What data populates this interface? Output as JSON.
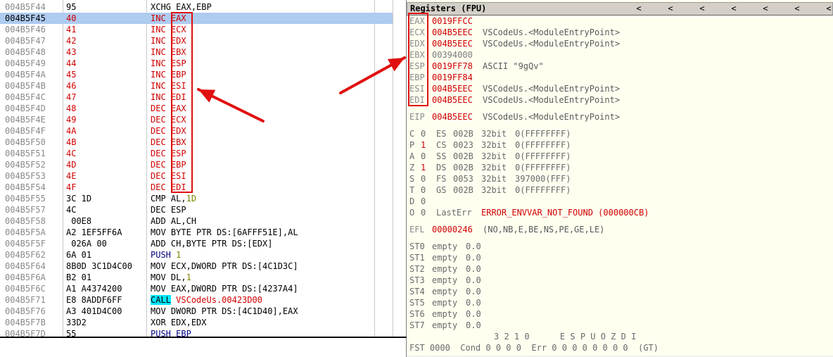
{
  "disassembly": {
    "rows": [
      {
        "addr": "004B5F44",
        "hex": "95",
        "mn": "XCHG",
        "ops": "EAX,EBP",
        "style": "plain"
      },
      {
        "addr": "004B5F45",
        "hex": "40",
        "mn": "INC",
        "ops": "EAX",
        "style": "red"
      },
      {
        "addr": "004B5F46",
        "hex": "41",
        "mn": "INC",
        "ops": "ECX",
        "style": "red"
      },
      {
        "addr": "004B5F47",
        "hex": "42",
        "mn": "INC",
        "ops": "EDX",
        "style": "red"
      },
      {
        "addr": "004B5F48",
        "hex": "43",
        "mn": "INC",
        "ops": "EBX",
        "style": "red"
      },
      {
        "addr": "004B5F49",
        "hex": "44",
        "mn": "INC",
        "ops": "ESP",
        "style": "red"
      },
      {
        "addr": "004B5F4A",
        "hex": "45",
        "mn": "INC",
        "ops": "EBP",
        "style": "red"
      },
      {
        "addr": "004B5F4B",
        "hex": "46",
        "mn": "INC",
        "ops": "ESI",
        "style": "red"
      },
      {
        "addr": "004B5F4C",
        "hex": "47",
        "mn": "INC",
        "ops": "EDI",
        "style": "red"
      },
      {
        "addr": "004B5F4D",
        "hex": "48",
        "mn": "DEC",
        "ops": "EAX",
        "style": "red"
      },
      {
        "addr": "004B5F4E",
        "hex": "49",
        "mn": "DEC",
        "ops": "ECX",
        "style": "red"
      },
      {
        "addr": "004B5F4F",
        "hex": "4A",
        "mn": "DEC",
        "ops": "EDX",
        "style": "red"
      },
      {
        "addr": "004B5F50",
        "hex": "4B",
        "mn": "DEC",
        "ops": "EBX",
        "style": "red"
      },
      {
        "addr": "004B5F51",
        "hex": "4C",
        "mn": "DEC",
        "ops": "ESP",
        "style": "red"
      },
      {
        "addr": "004B5F52",
        "hex": "4D",
        "mn": "DEC",
        "ops": "EBP",
        "style": "red"
      },
      {
        "addr": "004B5F53",
        "hex": "4E",
        "mn": "DEC",
        "ops": "ESI",
        "style": "red"
      },
      {
        "addr": "004B5F54",
        "hex": "4F",
        "mn": "DEC",
        "ops": "EDI",
        "style": "red"
      },
      {
        "addr": "004B5F55",
        "hex": "3C 1D",
        "mn": "CMP",
        "ops": "AL,",
        "num": "1D",
        "style": "num"
      },
      {
        "addr": "004B5F57",
        "hex": "4C",
        "mn": "DEC",
        "ops": "ESP",
        "style": "plain"
      },
      {
        "addr": "004B5F58",
        "hex": " 00E8",
        "mn": "ADD",
        "ops": "AL,CH",
        "style": "plain"
      },
      {
        "addr": "004B5F5A",
        "hex": "A2 1EF5FF6A",
        "mn": "MOV",
        "ops": "BYTE PTR DS:[6AFFF51E],AL",
        "style": "plain"
      },
      {
        "addr": "004B5F5F",
        "hex": " 026A 00",
        "mn": "ADD",
        "ops": "CH,BYTE PTR DS:[EDX]",
        "style": "plain"
      },
      {
        "addr": "004B5F62",
        "hex": "6A 01",
        "mn": "PUSH",
        "ops": "",
        "num": "1",
        "style": "push"
      },
      {
        "addr": "004B5F64",
        "hex": "8B0D 3C1D4C00",
        "mn": "MOV",
        "ops": "ECX,DWORD PTR DS:[4C1D3C]",
        "style": "plain"
      },
      {
        "addr": "004B5F6A",
        "hex": "B2 01",
        "mn": "MOV",
        "ops": "DL,",
        "num": "1",
        "style": "num"
      },
      {
        "addr": "004B5F6C",
        "hex": "A1 A4374200",
        "mn": "MOV",
        "ops": "EAX,DWORD PTR DS:[4237A4]",
        "style": "plain"
      },
      {
        "addr": "004B5F71",
        "hex": "E8 8ADDF6FF",
        "mn": "CALL",
        "ops": "VSCodeUs.00423D00",
        "style": "call"
      },
      {
        "addr": "004B5F76",
        "hex": "A3 401D4C00",
        "mn": "MOV",
        "ops": "DWORD PTR DS:[4C1D40],EAX",
        "style": "plain"
      },
      {
        "addr": "004B5F7B",
        "hex": "33D2",
        "mn": "XOR",
        "ops": "EDX,EDX",
        "style": "plain"
      },
      {
        "addr": "004B5F7D",
        "hex": "55",
        "mn": "PUSH",
        "ops": "EBP",
        "style": "pushreg"
      }
    ]
  },
  "registers": {
    "title": "Registers (FPU)",
    "nav_arrows": [
      "<",
      "<",
      "<",
      "<",
      "<",
      "<",
      "<"
    ],
    "gp": [
      {
        "name": "EAX",
        "value": "0019FFCC",
        "comment": "",
        "changed": true
      },
      {
        "name": "ECX",
        "value": "004B5EEC",
        "comment": "VSCodeUs.<ModuleEntryPoint>",
        "changed": true
      },
      {
        "name": "EDX",
        "value": "004B5EEC",
        "comment": "VSCodeUs.<ModuleEntryPoint>",
        "changed": true
      },
      {
        "name": "EBX",
        "value": "00394000",
        "comment": "",
        "changed": false
      },
      {
        "name": "ESP",
        "value": "0019FF78",
        "comment": "ASCII \"9gQv\"",
        "changed": true
      },
      {
        "name": "EBP",
        "value": "0019FF84",
        "comment": "",
        "changed": true
      },
      {
        "name": "ESI",
        "value": "004B5EEC",
        "comment": "VSCodeUs.<ModuleEntryPoint>",
        "changed": true
      },
      {
        "name": "EDI",
        "value": "004B5EEC",
        "comment": "VSCodeUs.<ModuleEntryPoint>",
        "changed": true
      }
    ],
    "eip": {
      "name": "EIP",
      "value": "004B5EEC",
      "comment": "VSCodeUs.<ModuleEntryPoint>"
    },
    "flags": [
      {
        "flag": "C",
        "bit": "0",
        "seg": "ES",
        "sel": "002B",
        "bits": "32bit",
        "range": "0(FFFFFFFF)",
        "changed": false
      },
      {
        "flag": "P",
        "bit": "1",
        "seg": "CS",
        "sel": "0023",
        "bits": "32bit",
        "range": "0(FFFFFFFF)",
        "changed": true
      },
      {
        "flag": "A",
        "bit": "0",
        "seg": "SS",
        "sel": "002B",
        "bits": "32bit",
        "range": "0(FFFFFFFF)",
        "changed": false
      },
      {
        "flag": "Z",
        "bit": "1",
        "seg": "DS",
        "sel": "002B",
        "bits": "32bit",
        "range": "0(FFFFFFFF)",
        "changed": true
      },
      {
        "flag": "S",
        "bit": "0",
        "seg": "FS",
        "sel": "0053",
        "bits": "32bit",
        "range": "397000(FFF)",
        "changed": false
      },
      {
        "flag": "T",
        "bit": "0",
        "seg": "GS",
        "sel": "002B",
        "bits": "32bit",
        "range": "0(FFFFFFFF)",
        "changed": false
      },
      {
        "flag": "D",
        "bit": "0",
        "seg": "",
        "sel": "",
        "bits": "",
        "range": "",
        "changed": false
      }
    ],
    "lasterr": {
      "flag": "O",
      "bit": "0",
      "label": "LastErr",
      "value": "ERROR_ENVVAR_NOT_FOUND (000000CB)"
    },
    "efl": {
      "label": "EFL",
      "value": "00000246",
      "desc": "(NO,NB,E,BE,NS,PE,GE,LE)"
    },
    "fpu": [
      {
        "name": "ST0",
        "state": "empty",
        "value": "0.0"
      },
      {
        "name": "ST1",
        "state": "empty",
        "value": "0.0"
      },
      {
        "name": "ST2",
        "state": "empty",
        "value": "0.0"
      },
      {
        "name": "ST3",
        "state": "empty",
        "value": "0.0"
      },
      {
        "name": "ST4",
        "state": "empty",
        "value": "0.0"
      },
      {
        "name": "ST5",
        "state": "empty",
        "value": "0.0"
      },
      {
        "name": "ST6",
        "state": "empty",
        "value": "0.0"
      },
      {
        "name": "ST7",
        "state": "empty",
        "value": "0.0"
      }
    ],
    "fst_header": "3 2 1 0      E S P U O Z D I",
    "fst_line": "FST 0000  Cond 0 0 0 0  Err 0 0 0 0 0 0 0 0  (GT)"
  },
  "colors": {
    "changed_value": "#d00000",
    "selection": "#aecbf0",
    "call_highlight": "#00e8ff",
    "annotation": "#e01010"
  }
}
